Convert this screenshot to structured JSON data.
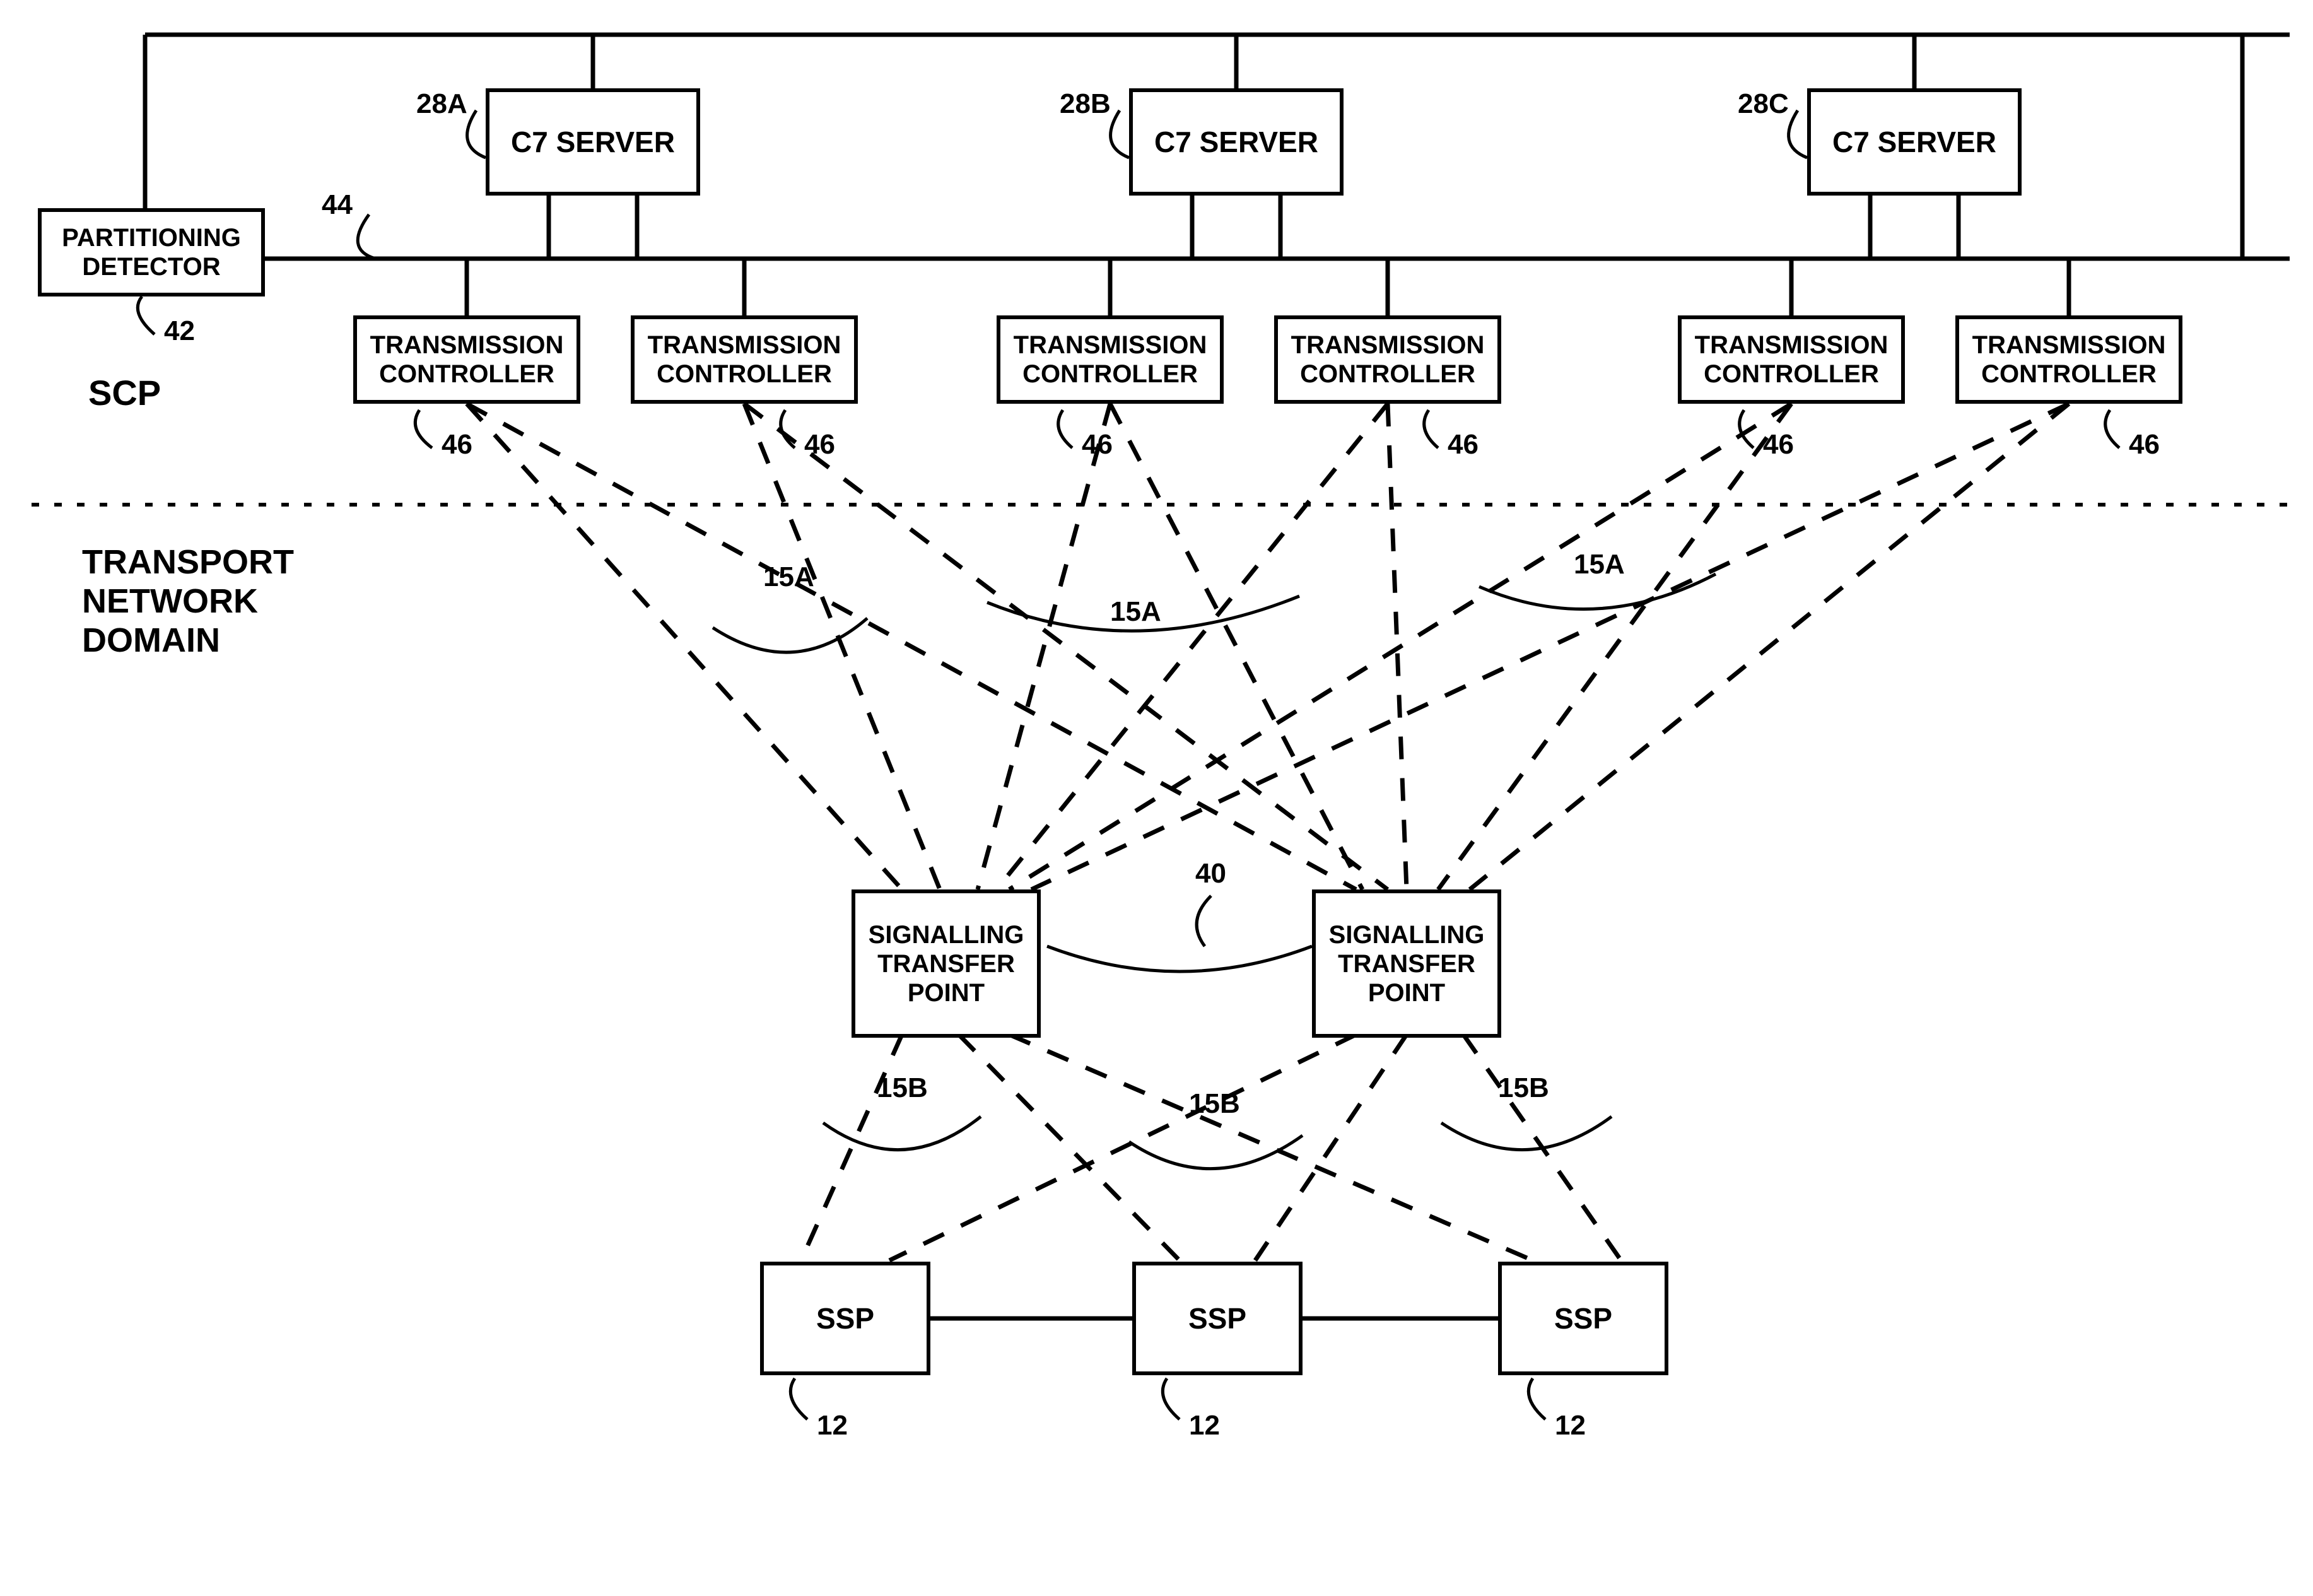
{
  "scp_label": "SCP",
  "tnd_label": "TRANSPORT\nNETWORK\nDOMAIN",
  "partitioning_detector": "PARTITIONING\nDETECTOR",
  "c7_server": "C7 SERVER",
  "transmission_controller": "TRANSMISSION\nCONTROLLER",
  "signalling_transfer_point": "SIGNALLING\nTRANSFER\nPOINT",
  "ssp": "SSP",
  "refs": {
    "r28a": "28A",
    "r28b": "28B",
    "r28c": "28C",
    "r42": "42",
    "r44": "44",
    "r46": "46",
    "r15a": "15A",
    "r15b": "15B",
    "r40": "40",
    "r12": "12",
    "r12p": "12"
  }
}
